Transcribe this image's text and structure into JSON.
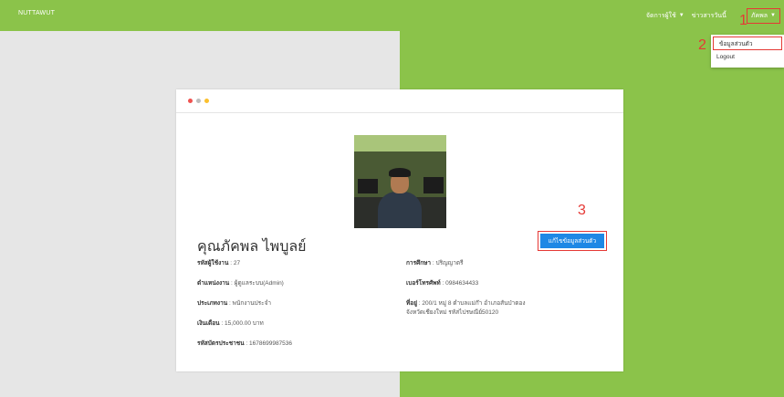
{
  "brand": "NUTTAWUT",
  "nav": {
    "item1": "จัดการผู้ใช้",
    "item2": "ข่าวสารวันนี้",
    "user": "ภัคพล"
  },
  "markers": [
    "1",
    "2",
    "3"
  ],
  "dropdown": {
    "profile": "ข้อมูลส่วนตัว",
    "logout": "Logout"
  },
  "profile": {
    "name": "คุณภัคพล ไพบูลย์",
    "edit_button": "แก้ไขข้อมูลส่วนตัว",
    "left": [
      {
        "label": "รหัสผู้ใช้งาน",
        "value": " : 27"
      },
      {
        "label": "ตำแหน่งงาน",
        "value": " : ผู้ดูแลระบบ(Admin)"
      },
      {
        "label": "ประเภทงาน",
        "value": " : พนักงานประจำ"
      },
      {
        "label": "เงินเดือน",
        "value": " : 15,000.00 บาท"
      },
      {
        "label": "รหัสบัตรประชาชน",
        "value": " : 1678699987536"
      }
    ],
    "right": [
      {
        "label": "การศึกษา",
        "value": " : ปริญญาตรี"
      },
      {
        "label": "เบอร์โทรศัพท์",
        "value": " : 0984634433"
      },
      {
        "label": "ที่อยู่",
        "value": " : 200/1 หมู่ 8 ตำบลแม่ก๊า อำเภอสันป่าตอง"
      },
      {
        "label": "",
        "value": "จังหวัดเชียงใหม่ รหัสไปรษณีย์50120"
      }
    ]
  },
  "colors": {
    "accent": "#8bc34a",
    "button": "#1e88e5",
    "highlight": "#e53935"
  }
}
